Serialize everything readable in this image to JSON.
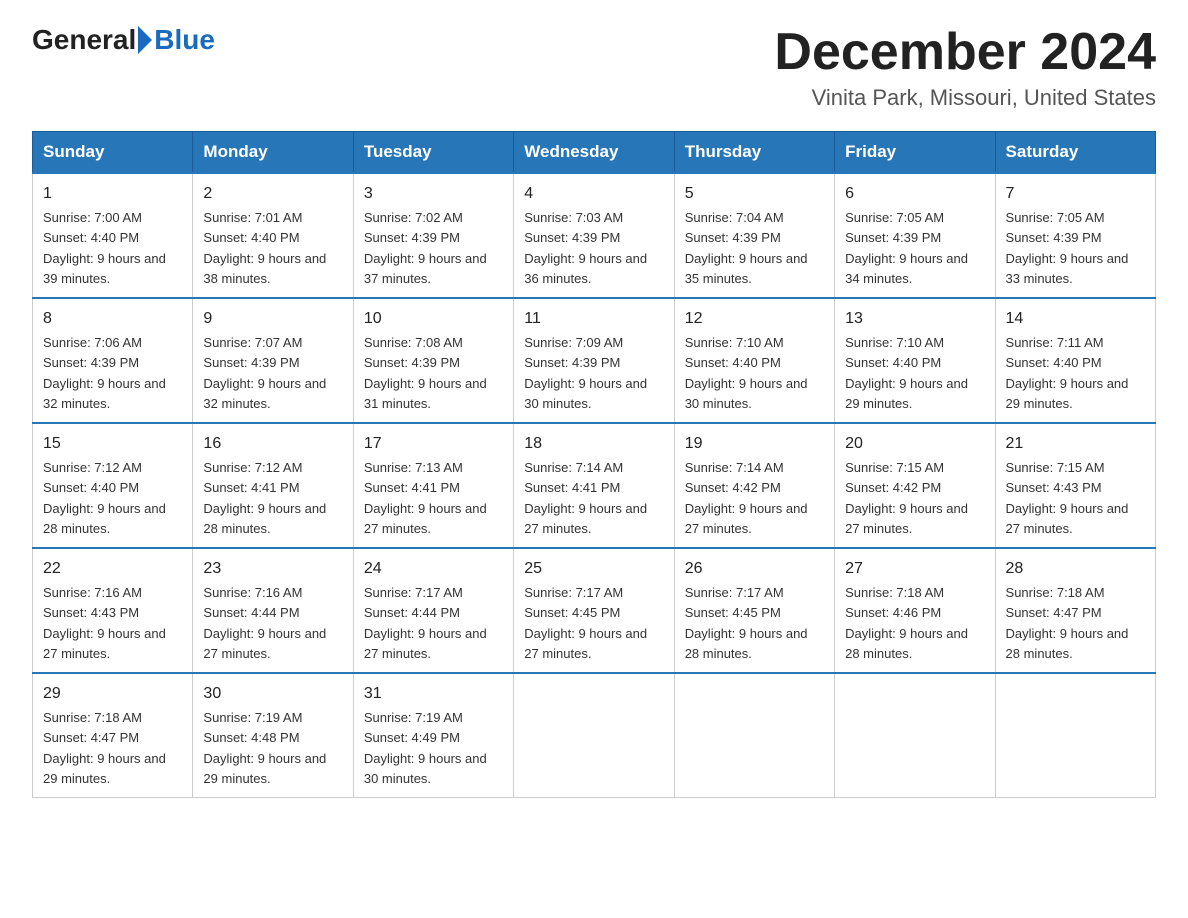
{
  "logo": {
    "general": "General",
    "blue": "Blue"
  },
  "title": "December 2024",
  "subtitle": "Vinita Park, Missouri, United States",
  "weekdays": [
    "Sunday",
    "Monday",
    "Tuesday",
    "Wednesday",
    "Thursday",
    "Friday",
    "Saturday"
  ],
  "weeks": [
    [
      {
        "day": "1",
        "sunrise": "7:00 AM",
        "sunset": "4:40 PM",
        "daylight": "9 hours and 39 minutes."
      },
      {
        "day": "2",
        "sunrise": "7:01 AM",
        "sunset": "4:40 PM",
        "daylight": "9 hours and 38 minutes."
      },
      {
        "day": "3",
        "sunrise": "7:02 AM",
        "sunset": "4:39 PM",
        "daylight": "9 hours and 37 minutes."
      },
      {
        "day": "4",
        "sunrise": "7:03 AM",
        "sunset": "4:39 PM",
        "daylight": "9 hours and 36 minutes."
      },
      {
        "day": "5",
        "sunrise": "7:04 AM",
        "sunset": "4:39 PM",
        "daylight": "9 hours and 35 minutes."
      },
      {
        "day": "6",
        "sunrise": "7:05 AM",
        "sunset": "4:39 PM",
        "daylight": "9 hours and 34 minutes."
      },
      {
        "day": "7",
        "sunrise": "7:05 AM",
        "sunset": "4:39 PM",
        "daylight": "9 hours and 33 minutes."
      }
    ],
    [
      {
        "day": "8",
        "sunrise": "7:06 AM",
        "sunset": "4:39 PM",
        "daylight": "9 hours and 32 minutes."
      },
      {
        "day": "9",
        "sunrise": "7:07 AM",
        "sunset": "4:39 PM",
        "daylight": "9 hours and 32 minutes."
      },
      {
        "day": "10",
        "sunrise": "7:08 AM",
        "sunset": "4:39 PM",
        "daylight": "9 hours and 31 minutes."
      },
      {
        "day": "11",
        "sunrise": "7:09 AM",
        "sunset": "4:39 PM",
        "daylight": "9 hours and 30 minutes."
      },
      {
        "day": "12",
        "sunrise": "7:10 AM",
        "sunset": "4:40 PM",
        "daylight": "9 hours and 30 minutes."
      },
      {
        "day": "13",
        "sunrise": "7:10 AM",
        "sunset": "4:40 PM",
        "daylight": "9 hours and 29 minutes."
      },
      {
        "day": "14",
        "sunrise": "7:11 AM",
        "sunset": "4:40 PM",
        "daylight": "9 hours and 29 minutes."
      }
    ],
    [
      {
        "day": "15",
        "sunrise": "7:12 AM",
        "sunset": "4:40 PM",
        "daylight": "9 hours and 28 minutes."
      },
      {
        "day": "16",
        "sunrise": "7:12 AM",
        "sunset": "4:41 PM",
        "daylight": "9 hours and 28 minutes."
      },
      {
        "day": "17",
        "sunrise": "7:13 AM",
        "sunset": "4:41 PM",
        "daylight": "9 hours and 27 minutes."
      },
      {
        "day": "18",
        "sunrise": "7:14 AM",
        "sunset": "4:41 PM",
        "daylight": "9 hours and 27 minutes."
      },
      {
        "day": "19",
        "sunrise": "7:14 AM",
        "sunset": "4:42 PM",
        "daylight": "9 hours and 27 minutes."
      },
      {
        "day": "20",
        "sunrise": "7:15 AM",
        "sunset": "4:42 PM",
        "daylight": "9 hours and 27 minutes."
      },
      {
        "day": "21",
        "sunrise": "7:15 AM",
        "sunset": "4:43 PM",
        "daylight": "9 hours and 27 minutes."
      }
    ],
    [
      {
        "day": "22",
        "sunrise": "7:16 AM",
        "sunset": "4:43 PM",
        "daylight": "9 hours and 27 minutes."
      },
      {
        "day": "23",
        "sunrise": "7:16 AM",
        "sunset": "4:44 PM",
        "daylight": "9 hours and 27 minutes."
      },
      {
        "day": "24",
        "sunrise": "7:17 AM",
        "sunset": "4:44 PM",
        "daylight": "9 hours and 27 minutes."
      },
      {
        "day": "25",
        "sunrise": "7:17 AM",
        "sunset": "4:45 PM",
        "daylight": "9 hours and 27 minutes."
      },
      {
        "day": "26",
        "sunrise": "7:17 AM",
        "sunset": "4:45 PM",
        "daylight": "9 hours and 28 minutes."
      },
      {
        "day": "27",
        "sunrise": "7:18 AM",
        "sunset": "4:46 PM",
        "daylight": "9 hours and 28 minutes."
      },
      {
        "day": "28",
        "sunrise": "7:18 AM",
        "sunset": "4:47 PM",
        "daylight": "9 hours and 28 minutes."
      }
    ],
    [
      {
        "day": "29",
        "sunrise": "7:18 AM",
        "sunset": "4:47 PM",
        "daylight": "9 hours and 29 minutes."
      },
      {
        "day": "30",
        "sunrise": "7:19 AM",
        "sunset": "4:48 PM",
        "daylight": "9 hours and 29 minutes."
      },
      {
        "day": "31",
        "sunrise": "7:19 AM",
        "sunset": "4:49 PM",
        "daylight": "9 hours and 30 minutes."
      },
      null,
      null,
      null,
      null
    ]
  ]
}
